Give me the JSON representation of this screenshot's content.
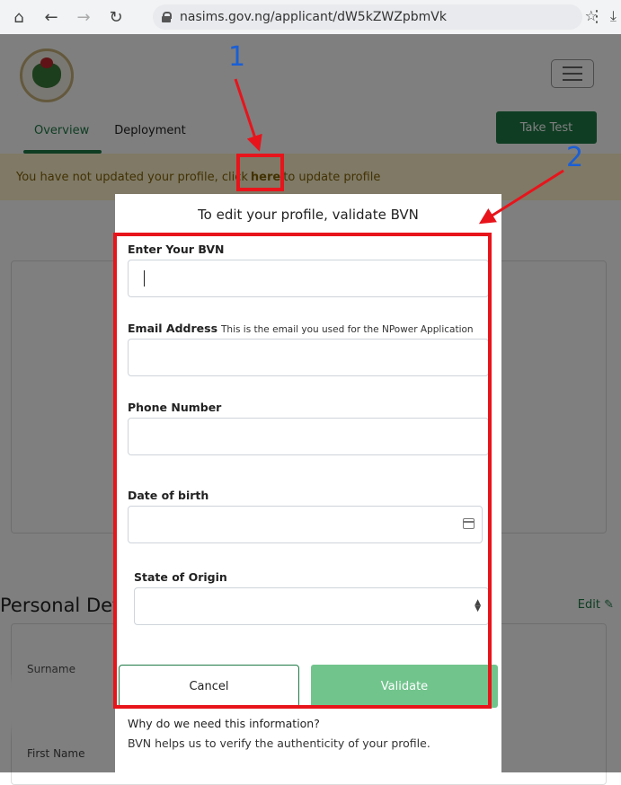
{
  "browser": {
    "url": "nasims.gov.ng/applicant/dW5kZWZpbmVk",
    "icons": [
      "home-icon",
      "back-icon",
      "forward-icon",
      "reload-icon",
      "lock-icon",
      "star-icon",
      "download-icon",
      "menu-icon"
    ]
  },
  "header": {
    "tabs": [
      "Overview",
      "Deployment"
    ],
    "take_test": "Take Test"
  },
  "alert": {
    "before": "You have not updated your profile, click",
    "link": "here",
    "after": "to update profile"
  },
  "section": {
    "title": "Personal Details",
    "edit": "Edit",
    "labels": [
      "Surname",
      "First Name"
    ]
  },
  "modal": {
    "title": "To edit your profile, validate BVN",
    "bvn_label": "Enter Your BVN",
    "email_label": "Email Address",
    "email_hint": "This is the email you used for the NPower Application",
    "phone_label": "Phone Number",
    "dob_label": "Date of birth",
    "state_label": "State of Origin",
    "cancel": "Cancel",
    "validate": "Validate",
    "why_title": "Why do we need this information?",
    "why_text": "BVN helps us to verify the authenticity of your profile."
  },
  "annotations": {
    "label_1": "1",
    "label_2": "2"
  },
  "colors": {
    "brand_green": "#1e7a46",
    "validate_green": "#72c48d",
    "alert_bg": "#fff3cd",
    "annotation_red": "#e8141b",
    "annotation_blue": "#1a5fd6"
  }
}
